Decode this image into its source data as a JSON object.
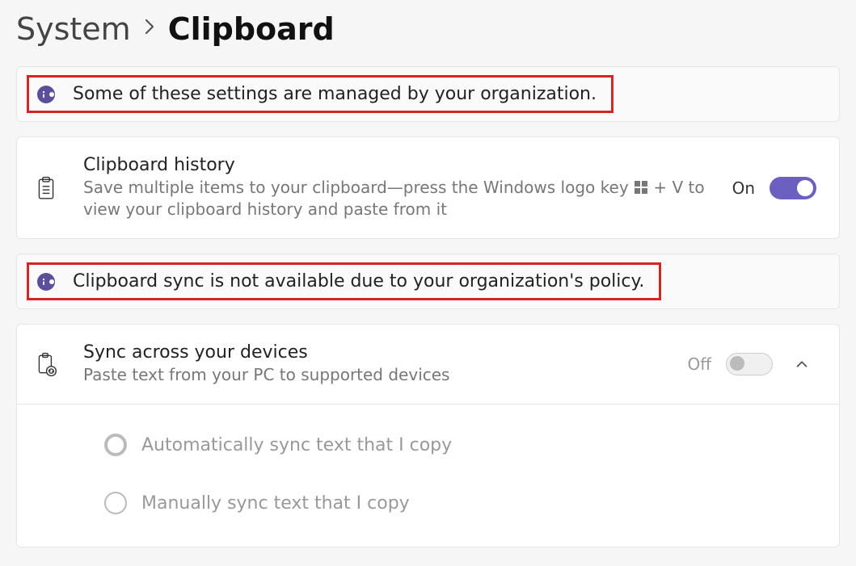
{
  "breadcrumb": {
    "parent": "System",
    "current": "Clipboard"
  },
  "banner_org_managed": "Some of these settings are managed by your organization.",
  "clipboard_history": {
    "title": "Clipboard history",
    "desc_pre": "Save multiple items to your clipboard—press the Windows logo key ",
    "desc_post": " + V to view your clipboard history and paste from it",
    "state_label": "On",
    "enabled": true
  },
  "banner_sync_unavailable": "Clipboard sync is not available due to your organization's policy.",
  "sync": {
    "title": "Sync across your devices",
    "desc": "Paste text from your PC to supported devices",
    "state_label": "Off",
    "enabled": false,
    "expanded": true
  },
  "sync_options": {
    "auto": "Automatically sync text that I copy",
    "manual": "Manually sync text that I copy"
  },
  "colors": {
    "accent": "#6b5fc0",
    "highlight_border": "#d62424",
    "info_badge": "#5b4e9b"
  }
}
